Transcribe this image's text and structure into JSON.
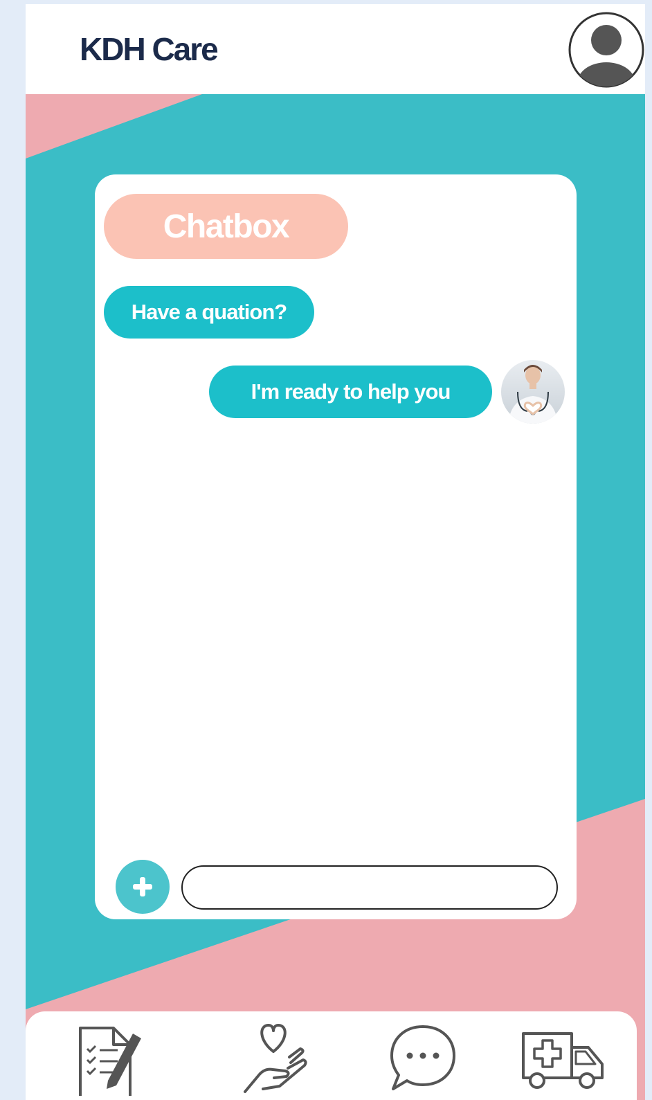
{
  "header": {
    "brand_title": "KDH Care"
  },
  "chat": {
    "title": "Chatbox",
    "messages": [
      {
        "side": "incoming",
        "text": "Have a quation?"
      },
      {
        "side": "outgoing",
        "text": "I'm ready to help you"
      }
    ],
    "input": {
      "value": "",
      "placeholder": ""
    }
  },
  "icons": {
    "profile": "user-avatar-icon",
    "add": "plus-icon",
    "nav": [
      "clipboard-checklist-icon",
      "heart-hand-icon",
      "speech-bubble-icon",
      "ambulance-icon"
    ]
  },
  "colors": {
    "teal_background": "#3bbdc6",
    "pink_background": "#eeaab0",
    "bubble_teal": "#1cbfca",
    "title_pill": "#fbc3b4",
    "brand_navy": "#1b2a4a",
    "icon_gray": "#555555"
  }
}
